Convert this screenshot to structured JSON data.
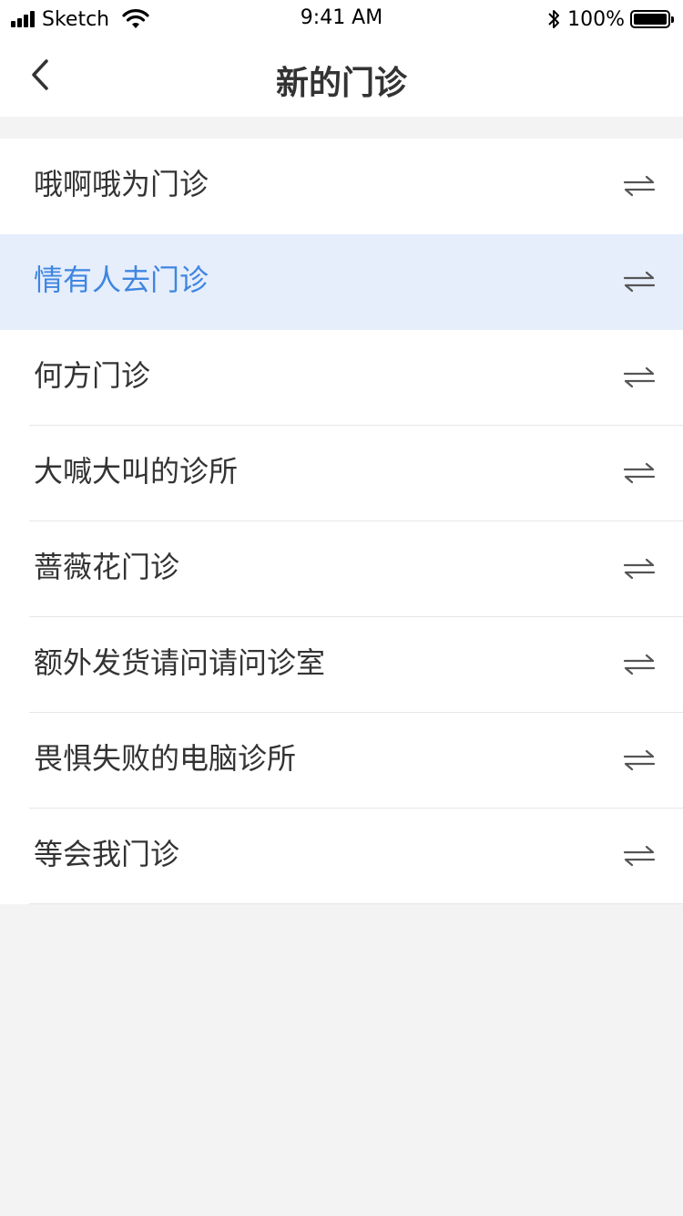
{
  "status_bar": {
    "carrier": "Sketch",
    "time": "9:41 AM",
    "battery": "100%"
  },
  "nav": {
    "title": "新的门诊",
    "back_icon": "chevron-left-icon"
  },
  "list": {
    "selected_index": 1,
    "accent_color": "#3f86e0",
    "selected_bg": "#e6eefc",
    "items": [
      {
        "label": "哦啊哦为门诊",
        "icon": "swap-arrows-icon"
      },
      {
        "label": "情有人去门诊",
        "icon": "swap-arrows-icon"
      },
      {
        "label": "何方门诊",
        "icon": "swap-arrows-icon"
      },
      {
        "label": "大喊大叫的诊所",
        "icon": "swap-arrows-icon"
      },
      {
        "label": "蔷薇花门诊",
        "icon": "swap-arrows-icon"
      },
      {
        "label": "额外发货请问请问诊室",
        "icon": "swap-arrows-icon"
      },
      {
        "label": "畏惧失败的电脑诊所",
        "icon": "swap-arrows-icon"
      },
      {
        "label": "等会我门诊",
        "icon": "swap-arrows-icon"
      }
    ]
  }
}
